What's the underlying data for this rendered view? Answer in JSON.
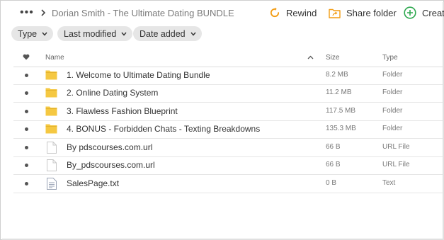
{
  "breadcrumb": {
    "more": "•••",
    "title": "Dorian Smith - The Ultimate Dating BUNDLE"
  },
  "actions": {
    "rewind": "Rewind",
    "share": "Share folder",
    "create": "Create"
  },
  "filters": {
    "type": "Type",
    "modified": "Last modified",
    "date_added": "Date added"
  },
  "columns": {
    "name": "Name",
    "size": "Size",
    "type": "Type"
  },
  "files": [
    {
      "name": "1. Welcome to Ultimate Dating Bundle",
      "size": "8.2 MB",
      "type": "Folder",
      "icon": "folder-icon"
    },
    {
      "name": "2. Online Dating System",
      "size": "11.2 MB",
      "type": "Folder",
      "icon": "folder-icon"
    },
    {
      "name": "3. Flawless Fashion Blueprint",
      "size": "117.5 MB",
      "type": "Folder",
      "icon": "folder-icon"
    },
    {
      "name": "4. BONUS - Forbidden Chats - Texting Breakdowns",
      "size": "135.3 MB",
      "type": "Folder",
      "icon": "folder-icon"
    },
    {
      "name": "By pdscourses.com.url",
      "size": "66 B",
      "type": "URL File",
      "icon": "file-icon"
    },
    {
      "name": "By_pdscourses.com.url",
      "size": "66 B",
      "type": "URL File",
      "icon": "file-icon"
    },
    {
      "name": "SalesPage.txt",
      "size": "0 B",
      "type": "Text",
      "icon": "text-file-icon"
    }
  ],
  "colors": {
    "accent": "#f39c12",
    "folder": "#f5c842",
    "create_green": "#2ea84f",
    "chip_bg": "#e6e6e6"
  }
}
